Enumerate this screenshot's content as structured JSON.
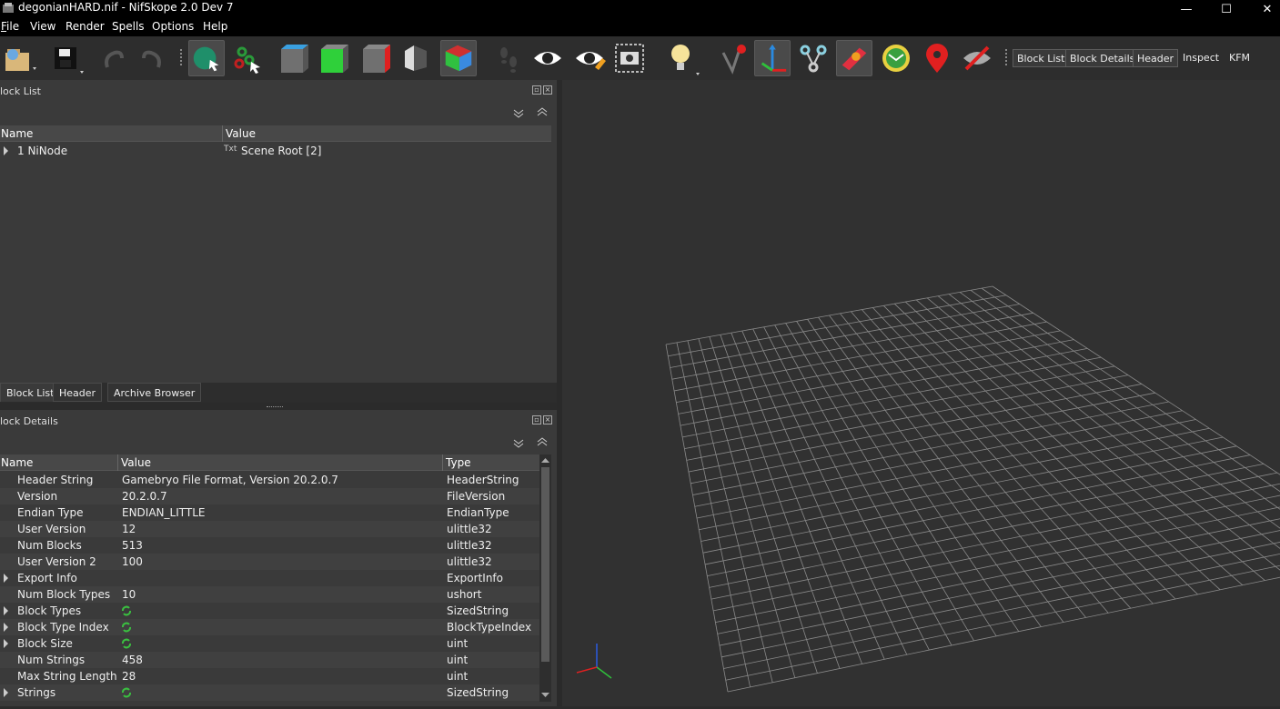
{
  "window": {
    "title": "degonianHARD.nif - NifSkope 2.0 Dev 7"
  },
  "menu": [
    {
      "label": "File",
      "u": "F",
      "rest": "ile"
    },
    {
      "label": "View"
    },
    {
      "label": "Render"
    },
    {
      "label": "Spells"
    },
    {
      "label": "Options"
    },
    {
      "label": "Help"
    }
  ],
  "toolbar": {
    "icons": [
      "open-file-icon",
      "save-file-icon",
      "undo-icon",
      "redo-icon",
      "select-object-icon",
      "select-vertex-icon",
      "view-top-icon",
      "view-front-icon",
      "view-side-icon",
      "view-perspective-icon",
      "view-user-icon",
      "walk-mode-icon",
      "show-hidden-icon",
      "show-nodes-icon",
      "screenshot-icon",
      "lighting-icon",
      "show-vertex-colors-icon",
      "show-axes-icon",
      "show-constraints-icon",
      "show-textures-icon",
      "show-markers-icon",
      "show-havok-icon",
      "show-decals-icon"
    ],
    "text_buttons": [
      "Block List",
      "Block Details",
      "Header",
      "Inspect",
      "KFM"
    ]
  },
  "block_list": {
    "title": "lock List",
    "columns": [
      "Name",
      "Value"
    ],
    "rows": [
      {
        "name": "1 NiNode",
        "value": "Scene Root [2]",
        "value_icon": "Txt"
      }
    ]
  },
  "tabs": [
    "Block List",
    "Header",
    "Archive Browser"
  ],
  "block_details": {
    "title": "lock Details",
    "columns": [
      "Name",
      "Value",
      "Type"
    ],
    "rows": [
      {
        "name": "Header String",
        "value": "Gamebryo File Format, Version 20.2.0.7",
        "type": "HeaderString",
        "expand": false
      },
      {
        "name": "Version",
        "value": "20.2.0.7",
        "type": "FileVersion",
        "expand": false
      },
      {
        "name": "Endian Type",
        "value": "ENDIAN_LITTLE",
        "type": "EndianType",
        "expand": false
      },
      {
        "name": "User Version",
        "value": "12",
        "type": "ulittle32",
        "expand": false
      },
      {
        "name": "Num Blocks",
        "value": "513",
        "type": "ulittle32",
        "expand": false
      },
      {
        "name": "User Version 2",
        "value": "100",
        "type": "ulittle32",
        "expand": false
      },
      {
        "name": "Export Info",
        "value": "",
        "type": "ExportInfo",
        "expand": true
      },
      {
        "name": "Num Block Types",
        "value": "10",
        "type": "ushort",
        "expand": false
      },
      {
        "name": "Block Types",
        "value": "",
        "type": "SizedString",
        "expand": true,
        "link": true
      },
      {
        "name": "Block Type Index",
        "value": "",
        "type": "BlockTypeIndex",
        "expand": true,
        "link": true
      },
      {
        "name": "Block Size",
        "value": "",
        "type": "uint",
        "expand": true,
        "link": true
      },
      {
        "name": "Num Strings",
        "value": "458",
        "type": "uint",
        "expand": false
      },
      {
        "name": "Max String Length",
        "value": "28",
        "type": "uint",
        "expand": false
      },
      {
        "name": "Strings",
        "value": "",
        "type": "SizedString",
        "expand": true,
        "link": true
      }
    ]
  },
  "colors": {
    "grid": "#8a8a8a",
    "viewport_bg": "#313131"
  }
}
